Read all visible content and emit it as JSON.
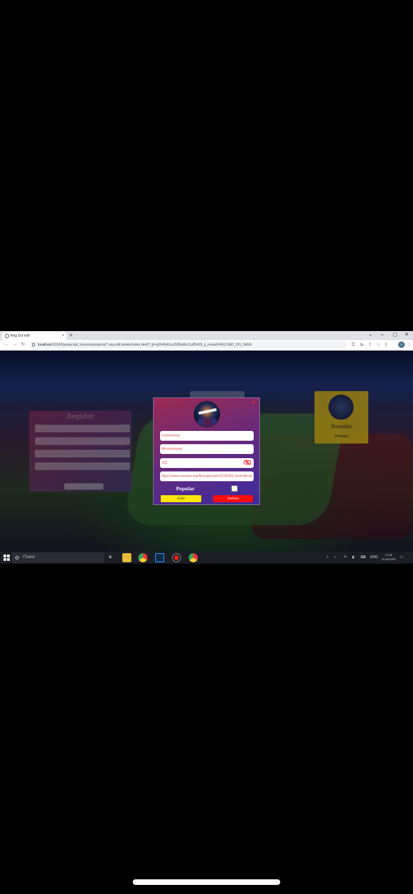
{
  "browser": {
    "tab_title": "Reg Dol edit",
    "tab_close": "×",
    "new_tab": "+",
    "url_host": "localhost",
    "url_rest": ":63342/javascript_lessons/projects/7.reg.edit.delete/index.html?_ijt=g3h4ht6cun508q4fsc1ufl5428_ij_reload=RELOAD_ON_SAVE",
    "window_controls": [
      "⌄",
      "–",
      "▢",
      "✕"
    ]
  },
  "background": {
    "register_title": "Register",
    "profile_name": "Ronaldo",
    "profile_tag": "Portugal"
  },
  "modal": {
    "close": "✕",
    "login_value": "Lionelmessi",
    "email_value": "Messiverjaaq",
    "password_value": "123",
    "photo_url_value": "https://www.montso.org/files/uploads/2018/09/Lionel-Messi",
    "popular_label": "Popular",
    "edit_label": "Edit",
    "delete_label": "Delete"
  },
  "taskbar": {
    "search_placeholder": "Поиск",
    "lang": "ENG",
    "time": "17:35",
    "date": "21.05.2023"
  },
  "colors": {
    "edit_button": "#ffe600",
    "delete_button": "#ff0d0d",
    "close_x": "#ff2a2a"
  }
}
